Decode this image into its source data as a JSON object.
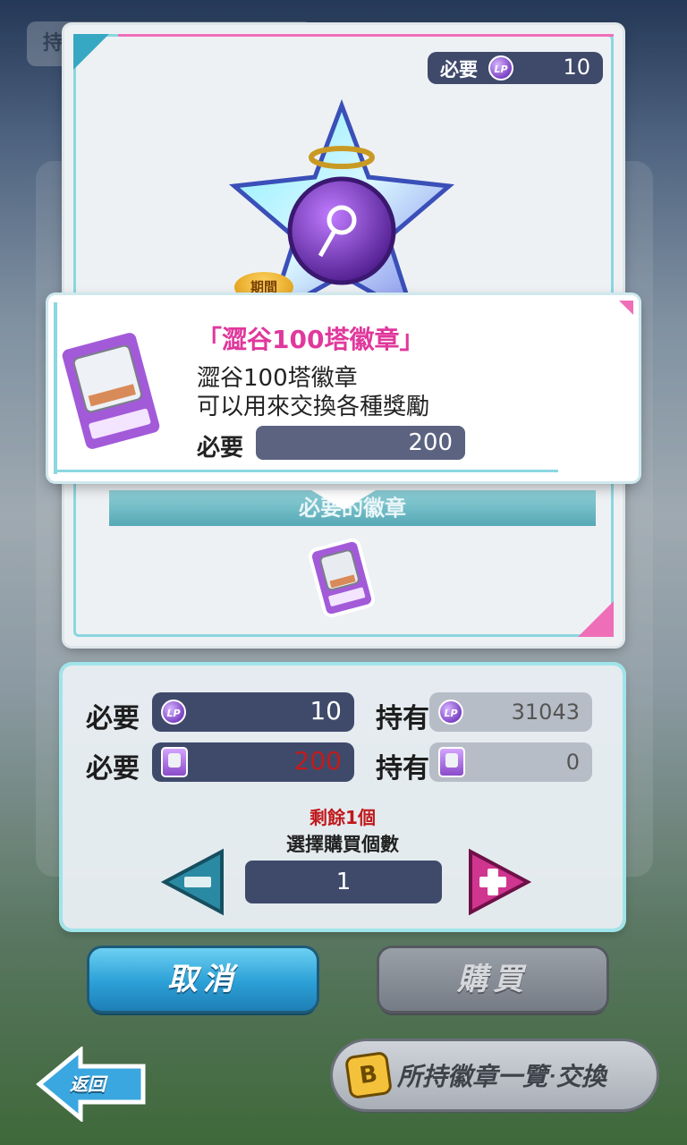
{
  "background": {
    "owned_label": "持有"
  },
  "item_card": {
    "required_label": "必要",
    "required_value": "10",
    "currency_icon": "lp-coin-icon",
    "limited_tag": "期間",
    "required_badges_bar": "必要的徽章"
  },
  "popup": {
    "title": "「澀谷100塔徽章」",
    "name": "澀谷100塔徽章",
    "description": "可以用來交換各種獎勵",
    "required_label": "必要",
    "required_value": "200"
  },
  "purchase": {
    "rows": [
      {
        "required_label": "必要",
        "required_value": "10",
        "owned_label": "持有",
        "owned_value": "31043",
        "icon": "lp-coin-icon"
      },
      {
        "required_label": "必要",
        "required_value": "200",
        "owned_label": "持有",
        "owned_value": "0",
        "icon": "tower-badge-icon"
      }
    ],
    "remaining": "剩餘1個",
    "select_quantity": "選擇購買個數",
    "quantity": "1"
  },
  "buttons": {
    "cancel": "取消",
    "buy": "購買",
    "back": "返回",
    "exchange": "所持徽章一覽‧交換",
    "exchange_icon_letter": "B"
  },
  "colors": {
    "accent_cyan": "#8ad7e0",
    "accent_pink": "#ee6fb8",
    "title_pink": "#e0389c",
    "value_box": "#3f4a6b",
    "insufficient_red": "#c21b1b"
  }
}
